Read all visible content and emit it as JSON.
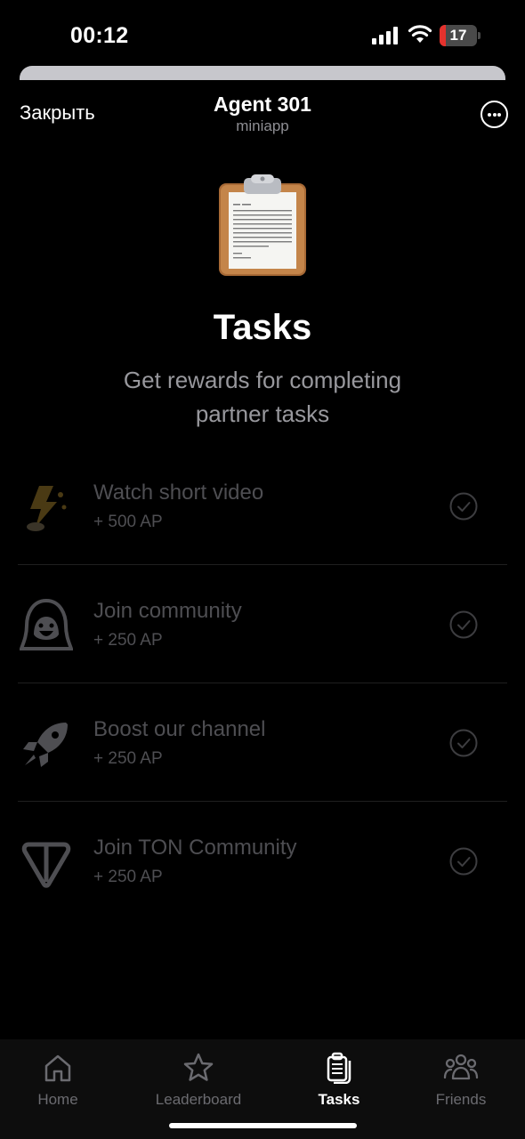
{
  "status_bar": {
    "time": "00:12",
    "battery_level": 17,
    "battery_label": "17",
    "battery_color": "#e5322d"
  },
  "header": {
    "close_label": "Закрыть",
    "title": "Agent 301",
    "subtitle": "miniapp",
    "more_icon": "ellipsis-circle-icon"
  },
  "hero": {
    "icon": "clipboard-icon",
    "title": "Tasks",
    "subtitle": "Get rewards for completing partner tasks"
  },
  "tasks": [
    {
      "icon": "lightning-icon",
      "title": "Watch short video",
      "reward": "+ 500 AP",
      "completed": true
    },
    {
      "icon": "agent-hood-icon",
      "title": "Join community",
      "reward": "+ 250 AP",
      "completed": true
    },
    {
      "icon": "rocket-icon",
      "title": "Boost our channel",
      "reward": "+ 250 AP",
      "completed": true
    },
    {
      "icon": "ton-icon",
      "title": "Join TON Community",
      "reward": "+ 250 AP",
      "completed": true
    }
  ],
  "bottom_nav": {
    "items": [
      {
        "label": "Home",
        "icon": "home-icon",
        "active": false
      },
      {
        "label": "Leaderboard",
        "icon": "star-icon",
        "active": false
      },
      {
        "label": "Tasks",
        "icon": "tasks-icon",
        "active": true
      },
      {
        "label": "Friends",
        "icon": "friends-icon",
        "active": false
      }
    ],
    "active_color": "#ffffff",
    "inactive_color": "#6b6b70"
  }
}
